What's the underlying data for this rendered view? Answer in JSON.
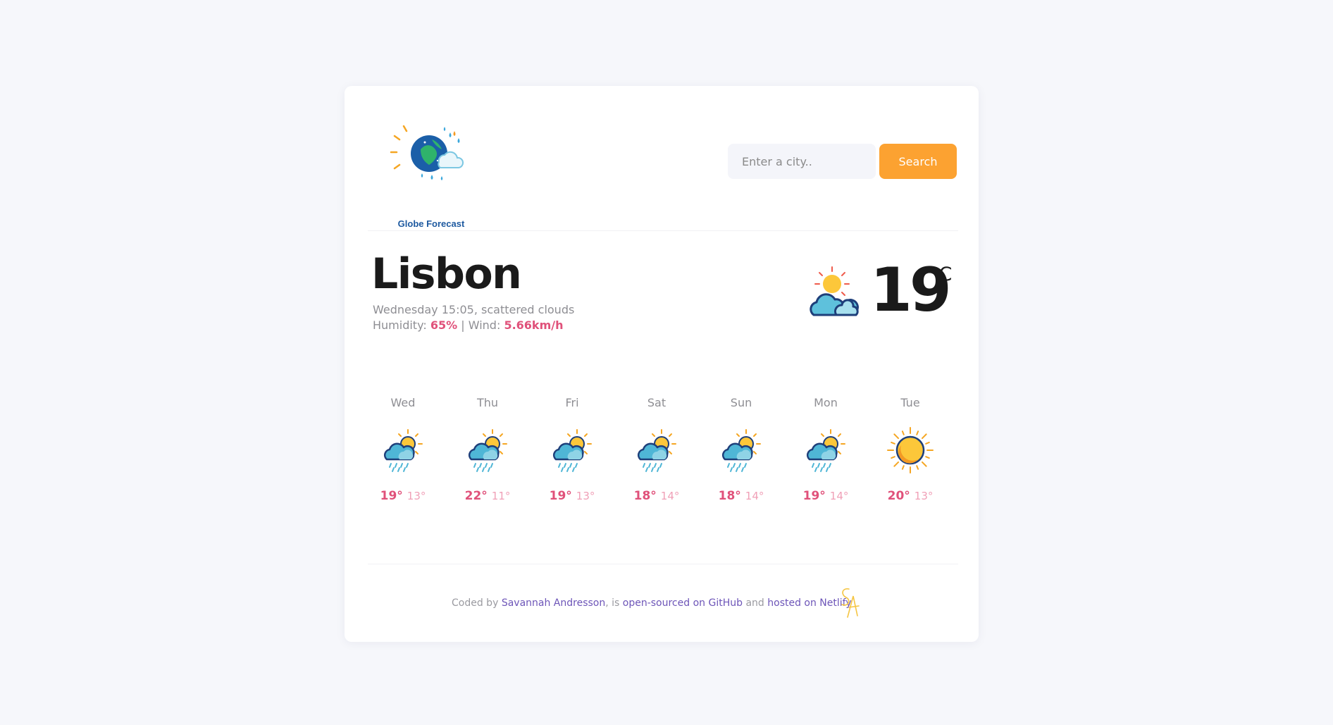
{
  "header": {
    "logo_text": "Globe Forecast",
    "search_placeholder": "Enter a city..",
    "search_button": "Search"
  },
  "current": {
    "city": "Lisbon",
    "description": "Wednesday 15:05, scattered clouds",
    "humidity_label": "Humidity:",
    "humidity_value": "65%",
    "separator": "|",
    "wind_label": "Wind:",
    "wind_value": "5.66km/h",
    "temperature": "19",
    "unit": "°C",
    "icon": "partly-cloudy-icon"
  },
  "forecast": [
    {
      "day": "Wed",
      "max": "19°",
      "min": "13°",
      "icon": "rain-sun-icon"
    },
    {
      "day": "Thu",
      "max": "22°",
      "min": "11°",
      "icon": "rain-sun-icon"
    },
    {
      "day": "Fri",
      "max": "19°",
      "min": "13°",
      "icon": "rain-sun-icon"
    },
    {
      "day": "Sat",
      "max": "18°",
      "min": "14°",
      "icon": "rain-sun-icon"
    },
    {
      "day": "Sun",
      "max": "18°",
      "min": "14°",
      "icon": "rain-sun-icon"
    },
    {
      "day": "Mon",
      "max": "19°",
      "min": "14°",
      "icon": "rain-sun-icon"
    },
    {
      "day": "Tue",
      "max": "20°",
      "min": "13°",
      "icon": "sun-icon"
    }
  ],
  "footer": {
    "coded_by": "Coded by",
    "author": "Savannah Andresson",
    "comma_is": ", is",
    "github_link": "open-sourced on GitHub",
    "and": "and",
    "netlify_link": "hosted on Netlify",
    "signature": "SA"
  },
  "colors": {
    "accent": "#fca231",
    "highlight": "#e0517a",
    "link": "#6d55b8",
    "background": "#f6f7fb"
  }
}
